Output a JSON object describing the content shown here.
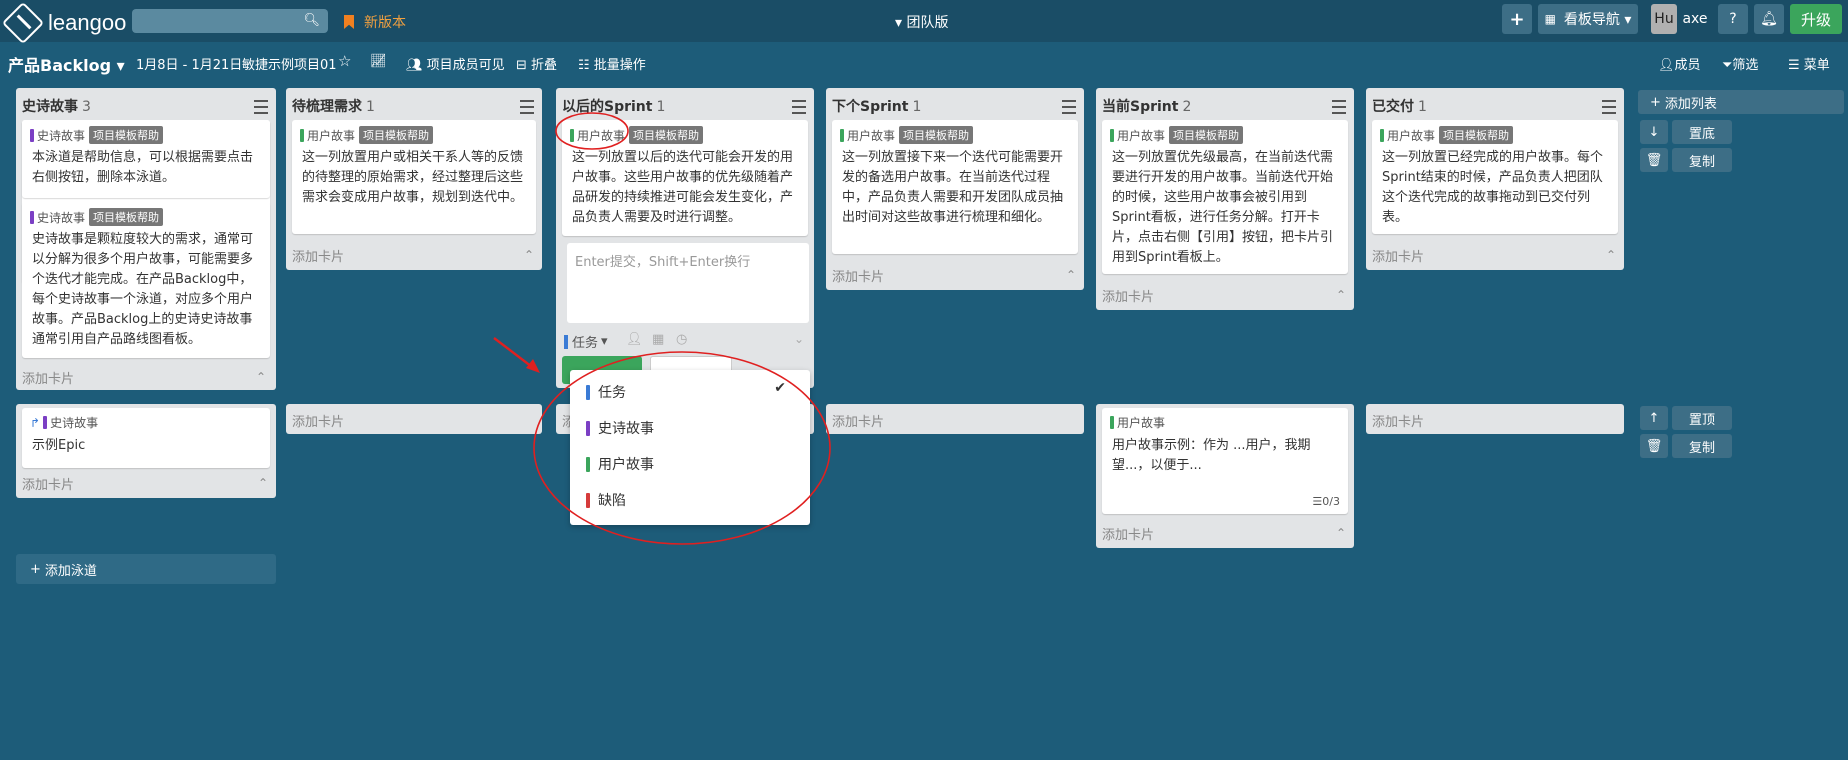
{
  "header": {
    "logo_text": "leangoo",
    "search_placeholder": "",
    "new_version": "新版本",
    "team": "▾ 团队版",
    "board_nav": "看板导航 ▾",
    "avatar": "Hu",
    "username": "axe",
    "help": "?",
    "upgrade": "升级"
  },
  "subbar": {
    "title": "产品Backlog ▾",
    "date_range": "1月8日 - 1月21日",
    "project": "敏捷示例项目01",
    "visibility": "项目成员可见",
    "fold": "折叠",
    "batch": "批量操作",
    "members": "成员",
    "filter": "筛选",
    "menu": "菜单"
  },
  "lists": [
    {
      "title": "史诗故事",
      "count": "3"
    },
    {
      "title": "待梳理需求",
      "count": "1"
    },
    {
      "title": "以后的Sprint",
      "count": "1"
    },
    {
      "title": "下个Sprint",
      "count": "1"
    },
    {
      "title": "当前Sprint",
      "count": "2"
    },
    {
      "title": "已交付",
      "count": "1"
    }
  ],
  "tags": {
    "epic": "史诗故事",
    "story": "用户故事",
    "help": "项目模板帮助"
  },
  "cards": {
    "c1": "本泳道是帮助信息，可以根据需要点击右侧按钮，删除本泳道。",
    "c2": "史诗故事是颗粒度较大的需求，通常可以分解为很多个用户故事，可能需要多个迭代才能完成。在产品Backlog中，每个史诗故事一个泳道，对应多个用户故事。产品Backlog上的史诗史诗故事通常引用自产品路线图看板。",
    "c3": "这一列放置用户或相关干系人等的反馈的待整理的原始需求，经过整理后这些需求会变成用户故事，规划到迭代中。",
    "c4": "这一列放置以后的迭代可能会开发的用户故事。这些用户故事的优先级随着产品研发的持续推进可能会发生变化，产品负责人需要及时进行调整。",
    "c5": "这一列放置接下来一个迭代可能需要开发的备选用户故事。在当前迭代过程中，产品负责人需要和开发团队成员抽出时间对这些故事进行梳理和细化。",
    "c6": "这一列放置优先级最高，在当前迭代需要进行开发的用户故事。当前迭代开始的时候，这些用户故事会被引用到Sprint看板，进行任务分解。打开卡片，点击右侧【引用】按钮，把卡片引用到Sprint看板上。",
    "c7": "这一列放置已经完成的用户故事。每个Sprint结束的时候，产品负责人把团队这个迭代完成的故事拖动到已交付列表。",
    "epic_example": "示例Epic",
    "story_example": "用户故事示例：作为 ...用户，我期望...，以便于...",
    "checklist": "☰0/3"
  },
  "composer": {
    "placeholder": "Enter提交，Shift+Enter换行",
    "type_label": "任务",
    "type_arrow": "▾"
  },
  "dropdown": {
    "items": [
      "任务",
      "史诗故事",
      "用户故事",
      "缺陷"
    ],
    "selected_mark": "✔"
  },
  "add_card": "添加卡片",
  "add_list": "添加列表",
  "add_lane": "添加泳道",
  "side": {
    "bottom": "置底",
    "copy": "复制",
    "top": "置顶"
  },
  "colors": {
    "epic": "#7b3fc4",
    "story": "#3ba55c",
    "task": "#3a7bd5",
    "bug": "#d63b3b",
    "annotation": "#e02020"
  }
}
